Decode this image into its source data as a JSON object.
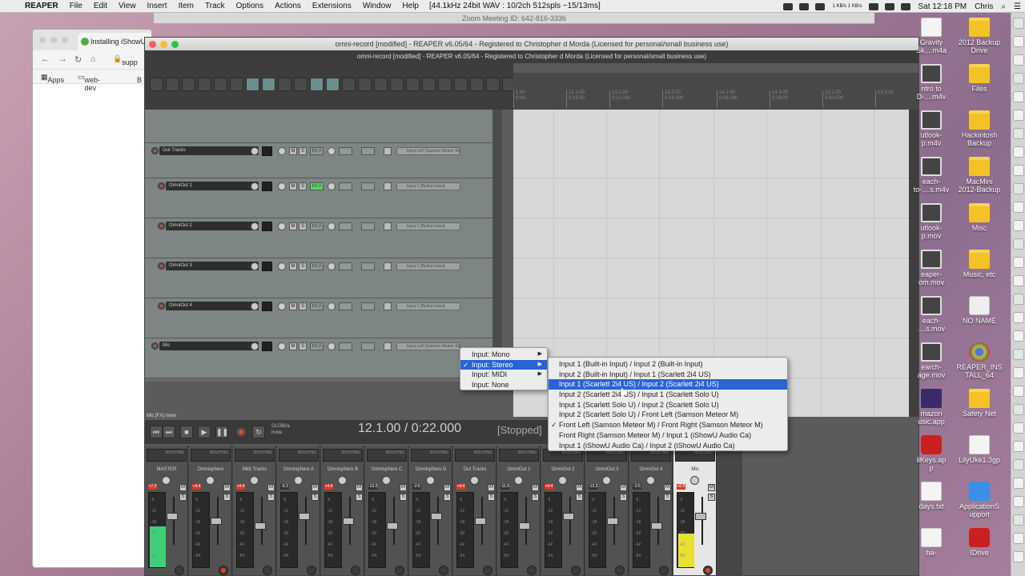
{
  "menubar": {
    "app": "REAPER",
    "items": [
      "File",
      "Edit",
      "View",
      "Insert",
      "Item",
      "Track",
      "Options",
      "Actions",
      "Extensions",
      "Window",
      "Help"
    ],
    "status": "[44.1kHz 24bit WAV : 10/2ch 512spls ~15/13ms]",
    "net": "1 KB/s 1 KB/s",
    "clock": "Sat 12:18 PM",
    "user": "Chris"
  },
  "zoom_strip": "Zoom Meeting ID: 642-816-3336",
  "chrome": {
    "tab_title": "Installing iShowU",
    "address": "supp",
    "bookmarks": [
      "Apps",
      "web-dev",
      "B"
    ]
  },
  "reaper": {
    "title": "omni-record [modified] - REAPER v6.05/64 - Registered to Christopher d Morda (Licensed for personal/small business use)",
    "subtitle": "omni-record [modified] - REAPER v6.05/64 - Registered to Christopher d Morda (Licensed for personal/small business use)",
    "ruler_ticks": [
      "1.00",
      "12.1.00",
      "13.1.00",
      "13.3.00",
      "14.1.00",
      "14.3.00",
      "15.1.00",
      "15.3.00"
    ],
    "ruler_sub": [
      "0:00",
      "0:15.00",
      "0:22.000",
      "0:24.000",
      "0:26.000",
      "0:28.00",
      "0:30.000"
    ],
    "tracks": [
      {
        "name": "Out Tracks",
        "input": "Input Left (Samson Meteor M)",
        "fx_active": false
      },
      {
        "name": "OmniOut 1",
        "input": "Input 1 (Built-in Input)",
        "fx_active": true
      },
      {
        "name": "OmniOut 2",
        "input": "Input 1 (Built-in Input)",
        "fx_active": false
      },
      {
        "name": "OmniOut 3",
        "input": "Input 1 (Built-in Input)",
        "fx_active": false
      },
      {
        "name": "OmniOut 4",
        "input": "Input 1 (Built-in Input)",
        "fx_active": false
      },
      {
        "name": "Mic",
        "input": "Input Left (Samson Meteor M)",
        "fx_active": false
      }
    ],
    "status_line": "Mic [FX] none",
    "transport": {
      "time": "12.1.00 / 0:22.000",
      "state": "[Stopped]",
      "global": "GLOBAL",
      "global_mode": "none"
    },
    "mixer": [
      {
        "name": "MASTER",
        "peak": "+7.3",
        "peak2": "+6.5",
        "hot": true,
        "level": 0.55,
        "armed": false
      },
      {
        "name": "Omnisphere",
        "peak": "+4.4",
        "hot": true,
        "level": 0.0,
        "armed": true
      },
      {
        "name": "Midi Tracks",
        "peak": "+4.4",
        "hot": true,
        "level": 0.0,
        "armed": false
      },
      {
        "name": "Omnisphere A",
        "peak": "-6.3",
        "hot": false,
        "level": 0.0,
        "armed": false
      },
      {
        "name": "Omnisphere B",
        "peak": "+4.4",
        "hot": true,
        "level": 0.0,
        "armed": false
      },
      {
        "name": "Omnisphere C",
        "peak": "-13.2",
        "hot": false,
        "level": 0.0,
        "armed": false
      },
      {
        "name": "Omnisphere D",
        "peak": "-2.6",
        "hot": false,
        "level": 0.0,
        "armed": false
      },
      {
        "name": "Out Tracks",
        "peak": "+4.4",
        "hot": true,
        "level": 0.0,
        "armed": false
      },
      {
        "name": "OmniOut 1",
        "peak": "-11.6",
        "hot": false,
        "level": 0.0,
        "armed": false
      },
      {
        "name": "OmniOut 2",
        "peak": "+4.4",
        "hot": true,
        "level": 0.0,
        "armed": false
      },
      {
        "name": "OmniOut 3",
        "peak": "-13.2",
        "hot": false,
        "level": 0.0,
        "armed": false
      },
      {
        "name": "OmniOut 4",
        "peak": "-2.6",
        "hot": false,
        "level": 0.0,
        "armed": false
      },
      {
        "name": "Mic",
        "peak": "+0.8",
        "hot": true,
        "level": 0.45,
        "armed": true
      }
    ],
    "fader_labels": [
      "-6",
      "-12",
      "-18",
      "-30",
      "-42",
      "-54"
    ],
    "button_m": "M",
    "button_s": "S",
    "routing": "ROUTING"
  },
  "context_menu": {
    "items": [
      {
        "label": "Input: Mono",
        "checked": false,
        "submenu": true,
        "selected": false
      },
      {
        "label": "Input: Stereo",
        "checked": true,
        "submenu": true,
        "selected": true
      },
      {
        "label": "Input: MIDI",
        "checked": false,
        "submenu": true,
        "selected": false
      },
      {
        "label": "Input: None",
        "checked": false,
        "submenu": false,
        "selected": false
      }
    ]
  },
  "submenu": {
    "items": [
      {
        "label": "Input 1 (Built-in Input) / Input 2 (Built-in Input)",
        "checked": false,
        "highlighted": false
      },
      {
        "label": "Input 2 (Built-in Input) / Input 1 (Scarlett 2i4 US)",
        "checked": false,
        "highlighted": false
      },
      {
        "label": "Input 1 (Scarlett 2i4 US) / Input 2 (Scarlett 2i4 US)",
        "checked": false,
        "highlighted": true
      },
      {
        "label": "Input 2 (Scarlett 2i4 US) / Input 1 (Scarlett Solo U)",
        "checked": false,
        "highlighted": false
      },
      {
        "label": "Input 1 (Scarlett Solo U) / Input 2 (Scarlett Solo U)",
        "checked": false,
        "highlighted": false
      },
      {
        "label": "Input 2 (Scarlett Solo U) / Front Left (Samson Meteor M)",
        "checked": false,
        "highlighted": false
      },
      {
        "label": "Front Left (Samson Meteor M) / Front Right (Samson Meteor M)",
        "checked": true,
        "highlighted": false
      },
      {
        "label": "Front Right (Samson Meteor M) / Input 1 (iShowU Audio Ca)",
        "checked": false,
        "highlighted": false
      },
      {
        "label": "Input 1 (iShowU Audio Ca) / Input 2 (iShowU Audio Ca)",
        "checked": false,
        "highlighted": false
      }
    ]
  },
  "desktop_icons": [
    {
      "label": "Gravity\nSk....m4a",
      "type": "file"
    },
    {
      "label": "2012 Backup\nDrive",
      "type": "folder"
    },
    {
      "label": "ntro to\nD-....m4v",
      "type": "vid"
    },
    {
      "label": "Files",
      "type": "folder"
    },
    {
      "label": "utlook-\np.m4v",
      "type": "vid"
    },
    {
      "label": "Hackintosh\nBackup",
      "type": "folder"
    },
    {
      "label": "each-\nto-....s.m4v",
      "type": "vid"
    },
    {
      "label": "MacMini\n2012-Backup",
      "type": "folder"
    },
    {
      "label": "utlook-\np.mov",
      "type": "vid"
    },
    {
      "label": "Misc",
      "type": "folder"
    },
    {
      "label": "eaper-\nom.mov",
      "type": "vid"
    },
    {
      "label": "Music, etc",
      "type": "folder"
    },
    {
      "label": "each-\n....s.mov",
      "type": "vid"
    },
    {
      "label": "NO NAME",
      "type": "drive"
    },
    {
      "label": "earch-\nage.mov",
      "type": "vid"
    },
    {
      "label": "REAPER_INS\nTALL_64",
      "type": "chrome"
    },
    {
      "label": "mazon\nusic.app",
      "type": "app"
    },
    {
      "label": "Safety Net",
      "type": "folder"
    },
    {
      "label": "liKeys.ap\np",
      "type": "red"
    },
    {
      "label": "LilyUke1.3gp",
      "type": "file"
    },
    {
      "label": "days.txt",
      "type": "file"
    },
    {
      "label": "ApplicationS\nupport",
      "type": "blue"
    },
    {
      "label": "ba-",
      "type": "file"
    },
    {
      "label": "IDrive",
      "type": "red"
    }
  ]
}
